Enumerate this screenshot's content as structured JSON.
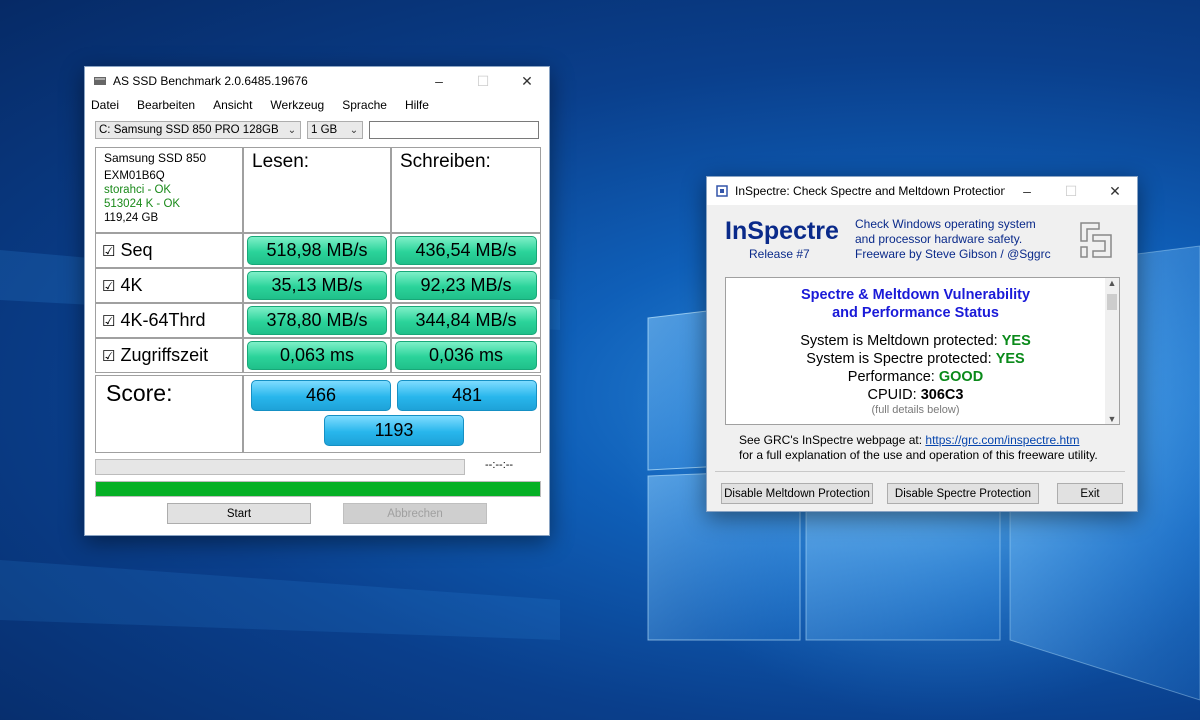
{
  "asssd": {
    "title": "AS SSD Benchmark 2.0.6485.19676",
    "menu": [
      "Datei",
      "Bearbeiten",
      "Ansicht",
      "Werkzeug",
      "Sprache",
      "Hilfe"
    ],
    "drive_select": "C: Samsung SSD 850 PRO 128GB",
    "size_select": "1 GB",
    "drive_info": {
      "model": "Samsung SSD 850",
      "firmware": "EXM01B6Q",
      "driver": "storahci - OK",
      "alignment": "513024 K - OK",
      "capacity": "119,24 GB"
    },
    "headers": {
      "read": "Lesen:",
      "write": "Schreiben:"
    },
    "rows": [
      {
        "label": "Seq",
        "read": "518,98 MB/s",
        "write": "436,54 MB/s"
      },
      {
        "label": "4K",
        "read": "35,13 MB/s",
        "write": "92,23 MB/s"
      },
      {
        "label": "4K-64Thrd",
        "read": "378,80 MB/s",
        "write": "344,84 MB/s"
      },
      {
        "label": "Zugriffszeit",
        "read": "0,063 ms",
        "write": "0,036 ms"
      }
    ],
    "score_label": "Score:",
    "score_read": "466",
    "score_write": "481",
    "score_total": "1193",
    "time": "--:--:--",
    "progress_fraction": 1.0,
    "start_label": "Start",
    "abort_label": "Abbrechen",
    "accent_progress": "#06b025"
  },
  "insp": {
    "title": "InSpectre: Check Spectre and Meltdown Protection",
    "brand": "InSpectre",
    "release": "Release #7",
    "tagline": [
      "Check Windows operating system",
      "and processor hardware safety.",
      "Freeware by Steve Gibson / @Sggrc"
    ],
    "vuln_title": [
      "Spectre & Meltdown Vulnerability",
      "and Performance Status"
    ],
    "meltdown_label": "System is Meltdown protected:",
    "meltdown_value": "YES",
    "spectre_label": "System is Spectre protected:",
    "spectre_value": "YES",
    "perf_label": "Performance:",
    "perf_value": "GOOD",
    "cpuid_label": "CPUID:",
    "cpuid_value": "306C3",
    "details_note": "(full details below)",
    "info_prefix": "See GRC's InSpectre webpage at:",
    "info_link": "https://grc.com/inspectre.htm",
    "info_line2": "for a full explanation of the use and operation of this freeware utility.",
    "btn_meltdown": "Disable Meltdown Protection",
    "btn_spectre": "Disable Spectre Protection",
    "btn_exit": "Exit"
  }
}
